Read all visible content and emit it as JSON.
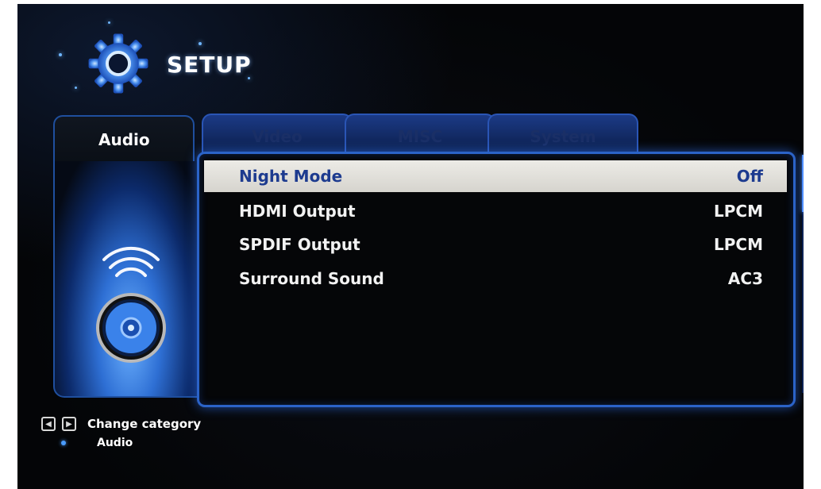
{
  "header": {
    "title": "SETUP",
    "icon": "gear-icon"
  },
  "tabs": [
    {
      "label": "Audio",
      "active": true
    },
    {
      "label": "Video",
      "active": false
    },
    {
      "label": "MISC",
      "active": false
    },
    {
      "label": "System",
      "active": false
    }
  ],
  "panel_icon": "speaker-icon",
  "settings": [
    {
      "label": "Night Mode",
      "value": "Off",
      "selected": true
    },
    {
      "label": "HDMI Output",
      "value": "LPCM",
      "selected": false
    },
    {
      "label": "SPDIF Output",
      "value": "LPCM",
      "selected": false
    },
    {
      "label": "Surround Sound",
      "value": "AC3",
      "selected": false
    }
  ],
  "footer": {
    "hint": "Change category",
    "current_category": "Audio"
  },
  "colors": {
    "accent": "#2b63c8",
    "selected_text": "#1d3b8f",
    "selected_bg": "#e4e2dc",
    "inactive_tab": "#1b3a86"
  }
}
